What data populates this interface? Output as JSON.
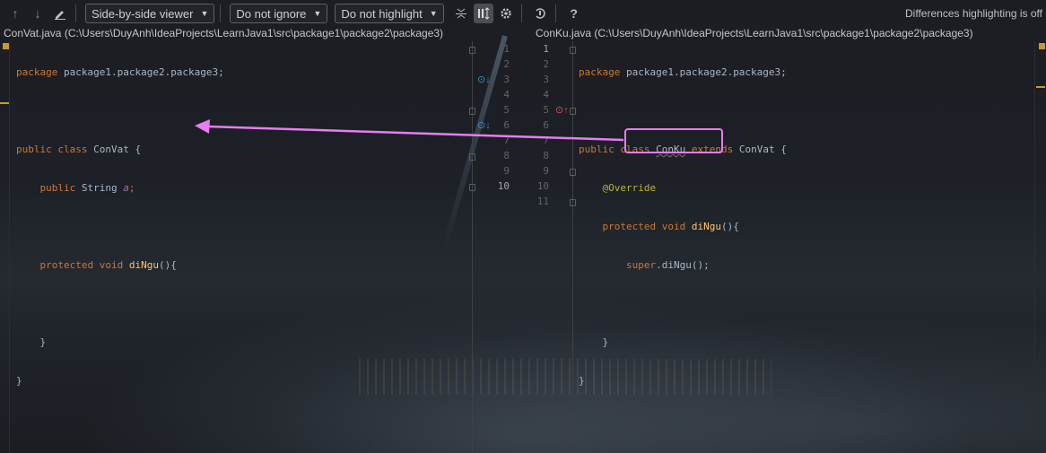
{
  "toolbar": {
    "viewer_label": "Side-by-side viewer",
    "ignore_label": "Do not ignore",
    "highlight_label": "Do not highlight",
    "help_label": "?",
    "status": "Differences highlighting is off"
  },
  "left_file": {
    "path": "ConVat.java (C:\\Users\\DuyAnh\\IdeaProjects\\LearnJava1\\src\\package1\\package2\\package3)"
  },
  "right_file": {
    "path": "ConKu.java (C:\\Users\\DuyAnh\\IdeaProjects\\LearnJava1\\src\\package1\\package2\\package3)"
  },
  "left_code": {
    "l1_kw": "package",
    "l1_rest": " package1.package2.package3;",
    "l3_kw1": "public",
    "l3_kw2": "class",
    "l3_rest": " ConVat {",
    "l4_kw": "public",
    "l4_type": " String ",
    "l4_var": "a",
    "l4_end": ";",
    "l6_kw1": "protected",
    "l6_kw2": "void",
    "l6_fn": "diNgu",
    "l6_end": "(){",
    "l8": "}",
    "l9": "}"
  },
  "right_code": {
    "l1_kw": "package",
    "l1_rest": " package1.package2.package3;",
    "l3_kw1": "public",
    "l3_kw2": "class",
    "l3_cls": "ConKu",
    "l3_kw3": "extends",
    "l3_rest": " ConVat {",
    "l4_ann": "@Override",
    "l5_kw1": "protected",
    "l5_kw2": "void",
    "l5_fn": "diNgu",
    "l5_end": "(){",
    "l6_kw": "super",
    "l6_rest": ".diNgu();",
    "l8": "}",
    "l9": "}"
  },
  "left_gutter": [
    "1",
    "2",
    "3",
    "4",
    "5",
    "6",
    "7",
    "8",
    "9",
    "10"
  ],
  "right_gutter": [
    "1",
    "2",
    "3",
    "4",
    "5",
    "6",
    "7",
    "8",
    "9",
    "10",
    "11"
  ],
  "icons": [
    "arrow-up-icon",
    "arrow-down-icon",
    "edit-icon",
    "collapse-icon",
    "sync-scroll-icon",
    "settings-icon",
    "history-icon",
    "help-icon",
    "override-down-icon",
    "override-up-icon"
  ],
  "colors": {
    "annotation_arrow": "#e87cf0",
    "keyword": "#cc7832",
    "function": "#ffc66d",
    "change_marker": "#c79a2a"
  }
}
